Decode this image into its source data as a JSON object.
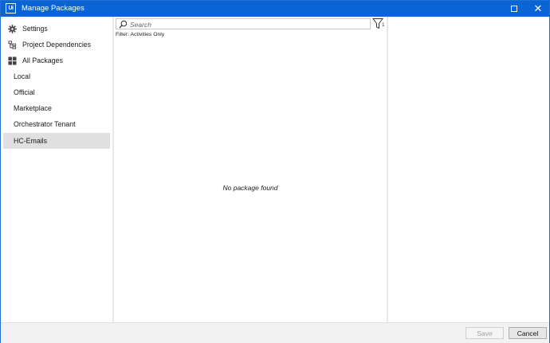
{
  "window": {
    "logo_text": "Ui",
    "title": "Manage Packages",
    "maximize_icon": "maximize-icon",
    "close_icon": "close-icon"
  },
  "sidebar": {
    "items": [
      {
        "label": "Settings",
        "icon": "gear-icon"
      },
      {
        "label": "Project Dependencies",
        "icon": "dependencies-icon"
      },
      {
        "label": "All Packages",
        "icon": "grid-icon"
      },
      {
        "label": "Local"
      },
      {
        "label": "Official"
      },
      {
        "label": "Marketplace"
      },
      {
        "label": "Orchestrator Tenant"
      },
      {
        "label": "HC-Emails",
        "selected": true
      }
    ]
  },
  "search": {
    "placeholder": "Search",
    "value": "",
    "icon": "search-icon"
  },
  "filter": {
    "icon": "filter-icon",
    "count": "1",
    "description": "Filter: Activities Only"
  },
  "results": {
    "empty_message": "No package found"
  },
  "footer": {
    "save_label": "Save",
    "cancel_label": "Cancel"
  },
  "colors": {
    "titlebar": "#0a64d3",
    "selected_item": "#e0e0e0"
  }
}
